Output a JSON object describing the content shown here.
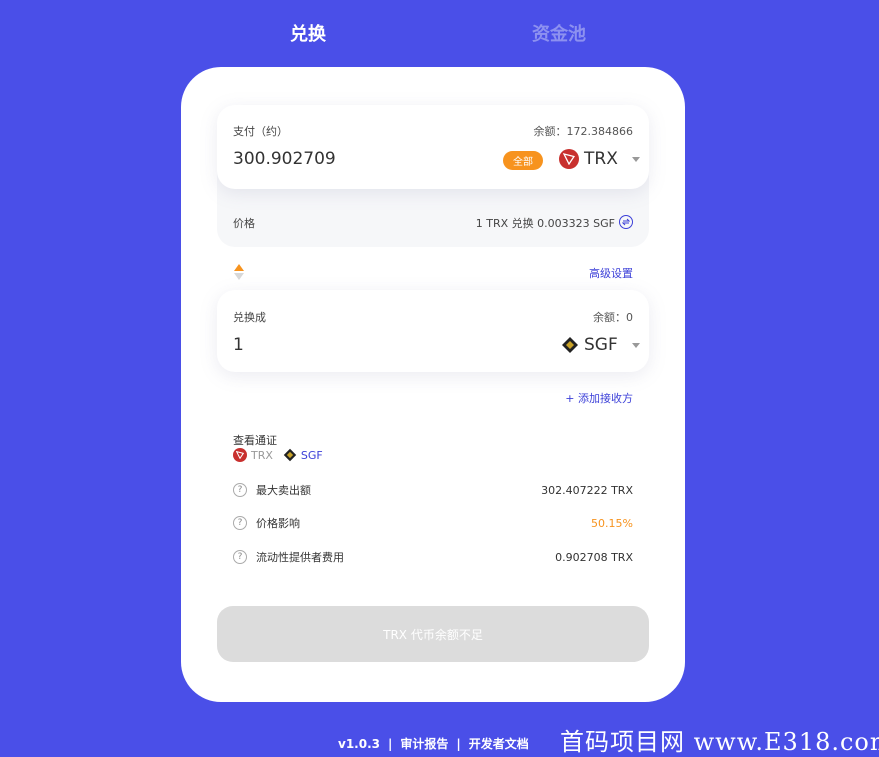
{
  "tabs": {
    "swap": "兑换",
    "pool": "资金池"
  },
  "pay": {
    "label": "支付（约）",
    "balance": "余额：172.384866",
    "amount": "300.902709",
    "all_button": "全部",
    "token": "TRX"
  },
  "price": {
    "label": "价格",
    "value": "1 TRX 兑换 0.003323 SGF"
  },
  "advanced_settings": "高级设置",
  "receive": {
    "label": "兑换成",
    "balance": "余额：0",
    "amount": "1",
    "token": "SGF"
  },
  "add_recipient": "+ 添加接收方",
  "view_tokens": {
    "label": "查看通证",
    "tokens": [
      "TRX",
      "SGF"
    ]
  },
  "details": [
    {
      "label": "最大卖出额",
      "value": "302.407222 TRX"
    },
    {
      "label": "价格影响",
      "value": "50.15%"
    },
    {
      "label": "流动性提供者费用",
      "value": "0.902708 TRX"
    }
  ],
  "submit_button": "TRX 代币余额不足",
  "footer": {
    "version": "v1.0.3",
    "audit": "审计报告",
    "docs": "开发者文档"
  },
  "watermark": "首码项目网 www.E318.com",
  "colors": {
    "background": "#4a4fe8",
    "accent": "#f7931e",
    "link": "#3b3fd8",
    "impact": "#f7931e"
  }
}
